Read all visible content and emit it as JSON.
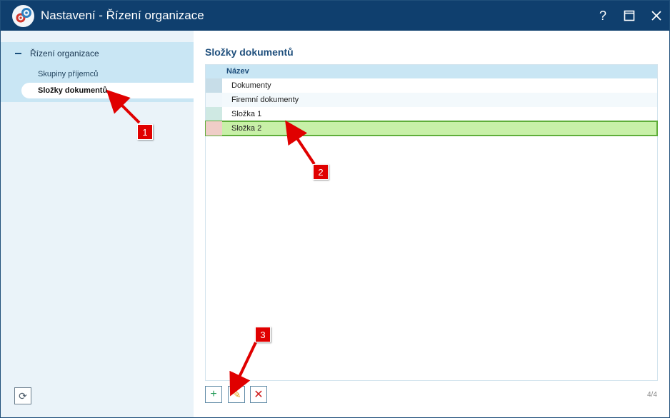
{
  "window": {
    "title": "Nastavení - Řízení organizace",
    "help_label": "?",
    "maximize_label": "☐",
    "close_label": "✕"
  },
  "sidebar": {
    "root": {
      "label": "Řízení organizace"
    },
    "items": [
      {
        "label": "Skupiny příjemců",
        "selected": false
      },
      {
        "label": "Složky dokumentů",
        "selected": true
      }
    ],
    "refresh_label": "⟳"
  },
  "main": {
    "title": "Složky dokumentů",
    "column_header": "Název",
    "rows": [
      {
        "name": "Dokumenty",
        "swatch": "#c7dde8"
      },
      {
        "name": "Firemní dokumenty",
        "swatch": "#f0f7fb"
      },
      {
        "name": "Složka 1",
        "swatch": "#cfe9e3"
      },
      {
        "name": "Složka 2",
        "swatch": "#efcdc7",
        "selected": true
      }
    ],
    "actions": {
      "add_label": "+",
      "edit_label": "✎",
      "delete_label": "✕"
    },
    "pager": "4/4"
  },
  "annotations": [
    {
      "number": "1"
    },
    {
      "number": "2"
    },
    {
      "number": "3"
    }
  ],
  "colors": {
    "titlebar": "#0f3f6e",
    "sidebar": "#eaf3f9",
    "accent": "#1f4f7c",
    "selected_row": "#c8f0a8",
    "callout": "#e00000"
  }
}
